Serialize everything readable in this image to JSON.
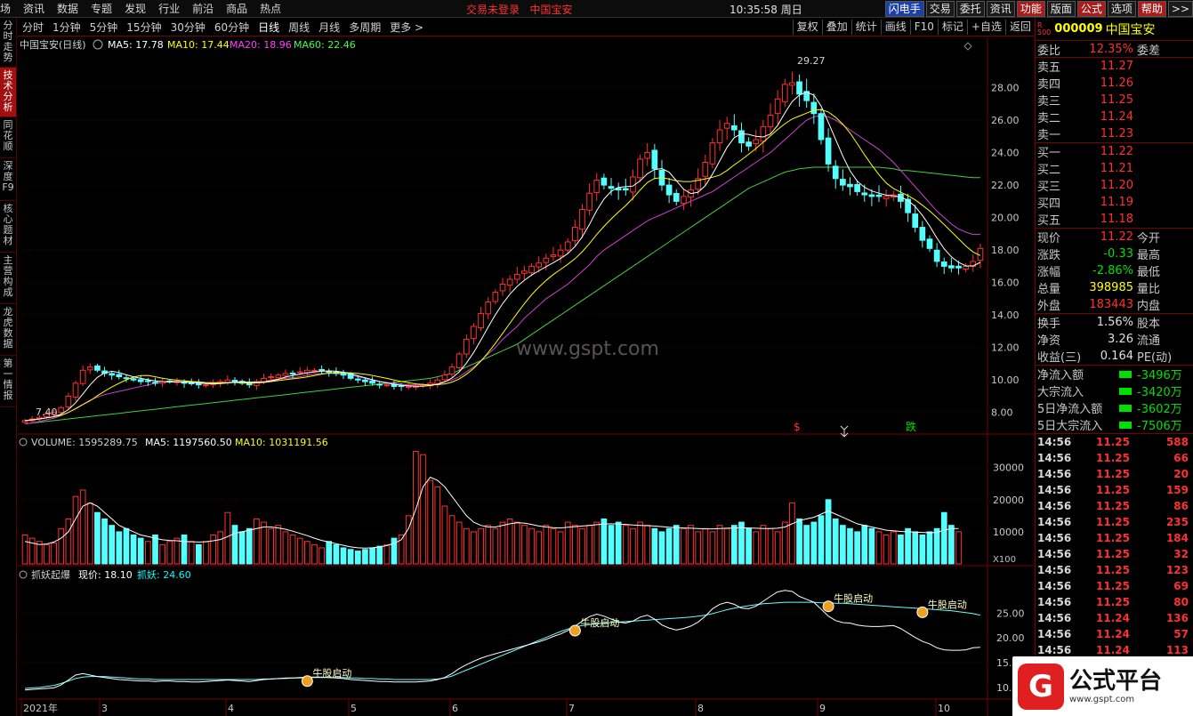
{
  "topbar": {
    "menu": [
      "场",
      "资讯",
      "数据",
      "专题",
      "发现",
      "行业",
      "前沿",
      "商品",
      "热点"
    ],
    "login": "交易未登录",
    "stock": "中国宝安",
    "time": "10:35:58",
    "weekday": "周日",
    "buttons": [
      "闪电手",
      "交易",
      "委托",
      "资讯",
      "功能",
      "版面",
      "公式",
      "选项",
      "帮助",
      ">>"
    ]
  },
  "leftnav": [
    "分时走势",
    "技术分析",
    "同花顺",
    "深度F9",
    "核心题材",
    "主营构成",
    "龙虎数据",
    "第一情报"
  ],
  "periods": [
    "分时",
    "1分钟",
    "5分钟",
    "15分钟",
    "30分钟",
    "60分钟",
    "日线",
    "周线",
    "月线",
    "多周期",
    "更多 >"
  ],
  "period_active": "日线",
  "chart_buttons": [
    "复权",
    "叠加",
    "统计",
    "画线",
    "F10",
    "标记",
    "+自选",
    "返回"
  ],
  "main_legend": {
    "name": "中国宝安(日线)",
    "ma5": "MA5: 17.78",
    "ma10": "MA10: 17.44",
    "ma20": "MA20: 18.96",
    "ma60": "MA60: 22.46",
    "high_label": "29.27",
    "low_label": "7.40",
    "mark_red": "$",
    "mark_green": "跌"
  },
  "vol_legend": {
    "vol": "VOLUME: 1595289.75",
    "ma5": "MA5: 1197560.50",
    "ma10": "MA10: 1031191.56",
    "unit": "X100"
  },
  "ind_legend": {
    "name": "抓妖起爆",
    "price": "现价: 18.10",
    "val": "抓妖: 24.60",
    "signal": "牛股启动"
  },
  "watermark_center": "www.gspt.com",
  "chart_data": [
    {
      "type": "line",
      "title": "中国宝安(日线)",
      "x": [
        "2021年",
        "3",
        "4",
        "5",
        "6",
        "7",
        "8",
        "9",
        "10"
      ],
      "ylim": [
        7,
        30
      ],
      "yticks": [
        8,
        10,
        12,
        14,
        16,
        18,
        20,
        22,
        24,
        26,
        28
      ],
      "close_series": [
        7.5,
        7.6,
        7.7,
        7.9,
        8.0,
        8.3,
        9.0,
        9.8,
        10.6,
        10.8,
        10.6,
        10.4,
        10.3,
        10.2,
        10.1,
        10.0,
        9.9,
        9.9,
        9.8,
        9.9,
        9.9,
        9.9,
        9.8,
        9.8,
        9.7,
        9.7,
        9.8,
        9.9,
        10.0,
        9.9,
        9.8,
        9.7,
        9.9,
        10.1,
        10.2,
        10.3,
        10.4,
        10.4,
        10.5,
        10.6,
        10.6,
        10.6,
        10.5,
        10.4,
        10.3,
        10.1,
        10.0,
        9.9,
        9.8,
        9.7,
        9.7,
        9.6,
        9.6,
        9.6,
        9.6,
        9.7,
        9.8,
        10.0,
        10.3,
        10.8,
        11.6,
        12.5,
        13.3,
        14.1,
        14.8,
        15.4,
        15.9,
        16.2,
        16.5,
        16.7,
        17.0,
        17.2,
        17.5,
        17.7,
        18.0,
        18.5,
        19.4,
        20.5,
        21.5,
        22.3,
        22.0,
        21.8,
        21.7,
        21.7,
        22.5,
        23.6,
        24.0,
        23.0,
        22.0,
        21.4,
        21.0,
        21.3,
        21.7,
        22.4,
        23.4,
        24.6,
        25.4,
        25.8,
        25.4,
        24.6,
        24.4,
        24.8,
        25.6,
        26.3,
        27.3,
        28.2,
        28.3,
        27.6,
        27.2,
        26.4,
        24.8,
        23.3,
        22.4,
        22.0,
        21.9,
        21.6,
        21.4,
        21.3,
        21.3,
        21.3,
        21.4,
        21.0,
        20.3,
        19.4,
        18.6,
        18.1,
        17.3,
        17.0,
        16.9,
        16.9,
        17.0,
        17.3,
        18.1
      ],
      "ma20_series": [
        7.3,
        7.35,
        7.45,
        7.55,
        7.65,
        7.8,
        8.0,
        8.25,
        8.5,
        8.75,
        8.95,
        9.1,
        9.2,
        9.3,
        9.4,
        9.5,
        9.6,
        9.7,
        9.8,
        9.85,
        9.9,
        9.95,
        9.95,
        9.9,
        9.9,
        9.85,
        9.85,
        9.85,
        9.85,
        9.85,
        9.85,
        9.85,
        9.9,
        9.9,
        10.0,
        10.05,
        10.1,
        10.15,
        10.2,
        10.3,
        10.35,
        10.4,
        10.4,
        10.4,
        10.35,
        10.3,
        10.2,
        10.1,
        10.0,
        9.9,
        9.85,
        9.8,
        9.75,
        9.7,
        9.7,
        9.7,
        9.75,
        9.8,
        9.9,
        10.0,
        10.2,
        10.5,
        10.8,
        11.2,
        11.6,
        12.0,
        12.5,
        12.9,
        13.3,
        13.8,
        14.2,
        14.6,
        15.0,
        15.3,
        15.6,
        15.9,
        16.3,
        16.7,
        17.1,
        17.6,
        18.0,
        18.3,
        18.6,
        18.9,
        19.2,
        19.5,
        19.8,
        20.0,
        20.2,
        20.4,
        20.6,
        20.8,
        21.0,
        21.2,
        21.4,
        21.6,
        21.9,
        22.2,
        22.5,
        22.8,
        23.1,
        23.4,
        23.7,
        24.0,
        24.4,
        24.8,
        25.2,
        25.6,
        26.0,
        26.2,
        26.3,
        26.2,
        26.0,
        25.7,
        25.4,
        25.1,
        24.8,
        24.5,
        24.2,
        23.8,
        23.4,
        22.9,
        22.4,
        21.9,
        21.4,
        20.9,
        20.4,
        20.0,
        19.6,
        19.3,
        19.1,
        18.96,
        18.96
      ],
      "ma60_series": [
        7.3,
        7.35,
        7.4,
        7.45,
        7.5,
        7.55,
        7.6,
        7.65,
        7.7,
        7.75,
        7.8,
        7.85,
        7.9,
        7.95,
        8.0,
        8.05,
        8.1,
        8.15,
        8.2,
        8.25,
        8.3,
        8.35,
        8.4,
        8.45,
        8.5,
        8.55,
        8.6,
        8.65,
        8.7,
        8.75,
        8.8,
        8.85,
        8.9,
        8.95,
        9.0,
        9.05,
        9.1,
        9.15,
        9.2,
        9.25,
        9.3,
        9.35,
        9.4,
        9.45,
        9.5,
        9.55,
        9.6,
        9.65,
        9.7,
        9.75,
        9.8,
        9.85,
        9.9,
        9.95,
        10.0,
        10.05,
        10.1,
        10.2,
        10.3,
        10.4,
        10.6,
        10.8,
        11.0,
        11.2,
        11.4,
        11.6,
        11.8,
        12.0,
        12.2,
        12.5,
        12.8,
        13.1,
        13.4,
        13.7,
        14.0,
        14.3,
        14.6,
        14.9,
        15.2,
        15.5,
        15.8,
        16.1,
        16.4,
        16.7,
        17.0,
        17.3,
        17.6,
        17.9,
        18.2,
        18.5,
        18.8,
        19.1,
        19.4,
        19.7,
        20.0,
        20.3,
        20.6,
        20.9,
        21.2,
        21.5,
        21.8,
        22.0,
        22.2,
        22.4,
        22.6,
        22.8,
        22.9,
        23.0,
        23.05,
        23.1,
        23.1,
        23.1,
        23.1,
        23.1,
        23.1,
        23.1,
        23.1,
        23.1,
        23.1,
        23.05,
        23.0,
        22.9,
        22.9,
        22.85,
        22.8,
        22.75,
        22.7,
        22.65,
        22.6,
        22.55,
        22.5,
        22.46,
        22.46
      ]
    },
    {
      "type": "bar",
      "title": "VOLUME",
      "ylim": [
        0,
        36000
      ],
      "yticks": [
        10000,
        20000,
        30000
      ],
      "values": [
        9000,
        8000,
        7000,
        6000,
        6500,
        11000,
        14000,
        21000,
        23000,
        19000,
        16000,
        14000,
        12000,
        10000,
        11000,
        9000,
        8000,
        7000,
        9000,
        6000,
        7000,
        8000,
        9000,
        7000,
        6000,
        7000,
        9000,
        10000,
        16000,
        12000,
        10000,
        11000,
        14000,
        13000,
        11000,
        12000,
        10000,
        9000,
        8000,
        7000,
        6000,
        5000,
        7000,
        6000,
        5000,
        4500,
        4000,
        4500,
        5000,
        5500,
        6000,
        8000,
        9000,
        15000,
        35000,
        34000,
        26000,
        24000,
        18000,
        15000,
        13000,
        11000,
        10000,
        11000,
        12000,
        11000,
        13000,
        14000,
        13000,
        12000,
        11000,
        10000,
        12000,
        11000,
        10000,
        13000,
        12000,
        11000,
        12000,
        13000,
        14000,
        12000,
        13000,
        12000,
        11000,
        13000,
        12000,
        11000,
        10000,
        11000,
        12000,
        11000,
        12000,
        10000,
        11000,
        10000,
        12000,
        11000,
        12000,
        13000,
        11000,
        10000,
        12000,
        11000,
        10000,
        13000,
        19000,
        14000,
        12000,
        13000,
        15000,
        20000,
        14000,
        12000,
        11000,
        10000,
        12000,
        11000,
        10000,
        9000,
        10000,
        9000,
        11000,
        10000,
        9000,
        10000,
        11000,
        16000,
        12000,
        10000
      ],
      "ma_values": [
        7000,
        6500,
        6000,
        6200,
        6800,
        8000,
        10000,
        14000,
        18000,
        19000,
        18000,
        16000,
        14000,
        12000,
        11000,
        10000,
        9000,
        8500,
        8000,
        7500,
        7300,
        7200,
        7000,
        6900,
        6800,
        6900,
        7200,
        7600,
        8500,
        9500,
        10000,
        10500,
        11000,
        11500,
        11500,
        11200,
        10800,
        10200,
        9500,
        8800,
        8000,
        7300,
        6800,
        6300,
        5800,
        5300,
        5000,
        4900,
        5000,
        5300,
        5700,
        6400,
        7500,
        11000,
        17000,
        24000,
        27000,
        26000,
        24000,
        21000,
        18000,
        15000,
        13000,
        12000,
        11500,
        11500,
        12000,
        12500,
        12800,
        12700,
        12300,
        11800,
        11500,
        11300,
        11200,
        11400,
        11600,
        11800,
        12000,
        12200,
        12400,
        12500,
        12400,
        12300,
        12100,
        12000,
        11900,
        11800,
        11600,
        11400,
        11300,
        11200,
        11100,
        11000,
        10900,
        10900,
        11000,
        11100,
        11200,
        11300,
        11200,
        11100,
        11000,
        11000,
        11100,
        11500,
        12500,
        13500,
        14000,
        14500,
        15500,
        16500,
        15500,
        14500,
        13500,
        12500,
        12000,
        11500,
        11000,
        10500,
        10300,
        10100,
        10000,
        9900,
        9800,
        9700,
        9800,
        10500,
        11000,
        11000
      ]
    },
    {
      "type": "line",
      "title": "抓妖起爆",
      "ylim": [
        8,
        31
      ],
      "yticks": [
        10,
        15,
        20,
        25
      ],
      "series": [
        {
          "name": "现价",
          "values": [
            9.5,
            9.6,
            9.7,
            9.8,
            9.9,
            10.5,
            11.5,
            12.5,
            12.8,
            12.5,
            12.2,
            12.0,
            11.8,
            11.6,
            11.5,
            11.4,
            11.3,
            11.3,
            11.2,
            11.3,
            11.3,
            11.2,
            11.2,
            11.1,
            11.1,
            11.2,
            11.3,
            11.4,
            11.5,
            11.4,
            11.3,
            11.2,
            11.4,
            11.6,
            11.7,
            11.8,
            11.9,
            11.9,
            12.0,
            12.1,
            12.1,
            12.1,
            12.0,
            11.9,
            11.8,
            11.6,
            11.5,
            11.4,
            11.3,
            11.2,
            11.2,
            11.1,
            11.1,
            11.1,
            11.1,
            11.2,
            11.3,
            11.6,
            12.0,
            12.8,
            13.8,
            14.6,
            15.3,
            15.9,
            16.4,
            16.8,
            17.2,
            17.6,
            18.0,
            18.4,
            18.8,
            19.2,
            19.7,
            20.3,
            20.8,
            21.5,
            22.4,
            23.4,
            24.3,
            24.8,
            24.4,
            23.8,
            23.2,
            23.0,
            23.4,
            24.2,
            24.6,
            23.8,
            22.6,
            22.0,
            21.6,
            21.9,
            22.4,
            23.2,
            24.4,
            25.9,
            26.8,
            27.2,
            26.8,
            26.0,
            25.9,
            26.4,
            27.4,
            28.4,
            29.3,
            29.6,
            29.4,
            28.4,
            27.8,
            27.2,
            25.8,
            24.4,
            23.5,
            23.1,
            23.0,
            22.6,
            22.4,
            22.3,
            22.3,
            22.4,
            22.5,
            21.9,
            21.0,
            20.1,
            19.3,
            18.8,
            18.0,
            17.6,
            17.5,
            17.5,
            17.6,
            18.0,
            18.1
          ]
        },
        {
          "name": "抓妖",
          "values": [
            9.8,
            9.9,
            10.0,
            10.2,
            10.4,
            10.8,
            11.3,
            11.8,
            12.1,
            12.2,
            12.2,
            12.2,
            12.1,
            12.0,
            11.9,
            11.8,
            11.7,
            11.7,
            11.6,
            11.6,
            11.6,
            11.6,
            11.6,
            11.6,
            11.6,
            11.6,
            11.6,
            11.6,
            11.6,
            11.6,
            11.6,
            11.6,
            11.6,
            11.7,
            11.7,
            11.8,
            11.8,
            11.9,
            11.9,
            12.0,
            12.0,
            12.0,
            12.0,
            12.0,
            12.0,
            11.9,
            11.9,
            11.8,
            11.8,
            11.7,
            11.7,
            11.6,
            11.6,
            11.6,
            11.6,
            11.6,
            11.6,
            11.7,
            11.9,
            12.3,
            12.9,
            13.5,
            14.1,
            14.7,
            15.3,
            15.9,
            16.5,
            17.1,
            17.7,
            18.3,
            18.9,
            19.5,
            20.1,
            20.7,
            21.3,
            21.8,
            22.2,
            22.5,
            22.7,
            22.9,
            23.0,
            23.1,
            23.2,
            23.3,
            23.4,
            23.5,
            23.6,
            23.7,
            23.8,
            23.9,
            24.0,
            24.1,
            24.2,
            24.4,
            24.6,
            24.9,
            25.3,
            25.7,
            26.0,
            26.3,
            26.5,
            26.7,
            26.9,
            27.0,
            27.1,
            27.2,
            27.2,
            27.2,
            27.2,
            27.2,
            27.1,
            27.1,
            27.0,
            27.0,
            26.9,
            26.8,
            26.7,
            26.6,
            26.5,
            26.4,
            26.3,
            26.2,
            26.1,
            26.0,
            25.9,
            25.8,
            25.7,
            25.6,
            25.5,
            25.3,
            25.1,
            24.9,
            24.6
          ]
        }
      ],
      "signals": [
        39,
        76,
        111,
        124
      ]
    }
  ],
  "quote": {
    "name": "中国宝安",
    "code": "000009",
    "weibi_label": "委比",
    "weibi": "12.35%",
    "weicha_label": "委差",
    "sell": [
      {
        "l": "卖五",
        "p": "11.27"
      },
      {
        "l": "卖四",
        "p": "11.26"
      },
      {
        "l": "卖三",
        "p": "11.25"
      },
      {
        "l": "卖二",
        "p": "11.24"
      },
      {
        "l": "卖一",
        "p": "11.23"
      }
    ],
    "buy": [
      {
        "l": "买一",
        "p": "11.22"
      },
      {
        "l": "买二",
        "p": "11.21"
      },
      {
        "l": "买三",
        "p": "11.20"
      },
      {
        "l": "买四",
        "p": "11.19"
      },
      {
        "l": "买五",
        "p": "11.18"
      }
    ],
    "stats": [
      {
        "l": "现价",
        "v": "11.22",
        "r": "今开",
        "c": "red"
      },
      {
        "l": "涨跌",
        "v": "-0.33",
        "r": "最高",
        "c": "green"
      },
      {
        "l": "涨幅",
        "v": "-2.86%",
        "r": "最低",
        "c": "green"
      },
      {
        "l": "总量",
        "v": "398985",
        "r": "量比",
        "c": "yel"
      },
      {
        "l": "外盘",
        "v": "183443",
        "r": "内盘",
        "c": "red"
      }
    ],
    "stats2": [
      {
        "l": "换手",
        "v": "1.56%",
        "r": "股本"
      },
      {
        "l": "净资",
        "v": "3.26",
        "r": "流通"
      },
      {
        "l": "收益(三)",
        "v": "0.164",
        "r": "PE(动)"
      }
    ],
    "flows": [
      {
        "l": "净流入额",
        "v": "-3496万"
      },
      {
        "l": "大宗流入",
        "v": "-3420万"
      },
      {
        "l": "5日净流入额",
        "v": "-3602万"
      },
      {
        "l": "5日大宗流入",
        "v": "-7506万"
      }
    ],
    "ticks": [
      {
        "t": "14:56",
        "p": "11.25",
        "v": "588"
      },
      {
        "t": "14:56",
        "p": "11.25",
        "v": "66"
      },
      {
        "t": "14:56",
        "p": "11.25",
        "v": "20"
      },
      {
        "t": "14:56",
        "p": "11.25",
        "v": "159"
      },
      {
        "t": "14:56",
        "p": "11.25",
        "v": "86"
      },
      {
        "t": "14:56",
        "p": "11.25",
        "v": "235"
      },
      {
        "t": "14:56",
        "p": "11.25",
        "v": "184"
      },
      {
        "t": "14:56",
        "p": "11.25",
        "v": "32"
      },
      {
        "t": "14:56",
        "p": "11.25",
        "v": "123"
      },
      {
        "t": "14:56",
        "p": "11.25",
        "v": "69"
      },
      {
        "t": "14:56",
        "p": "11.25",
        "v": "80"
      },
      {
        "t": "14:56",
        "p": "11.24",
        "v": "136"
      },
      {
        "t": "14:56",
        "p": "11.24",
        "v": "57"
      },
      {
        "t": "14:56",
        "p": "11.24",
        "v": "113"
      }
    ]
  },
  "watermark": {
    "logo": "G",
    "big": "公式平台",
    "small": "www.gspt.com"
  }
}
